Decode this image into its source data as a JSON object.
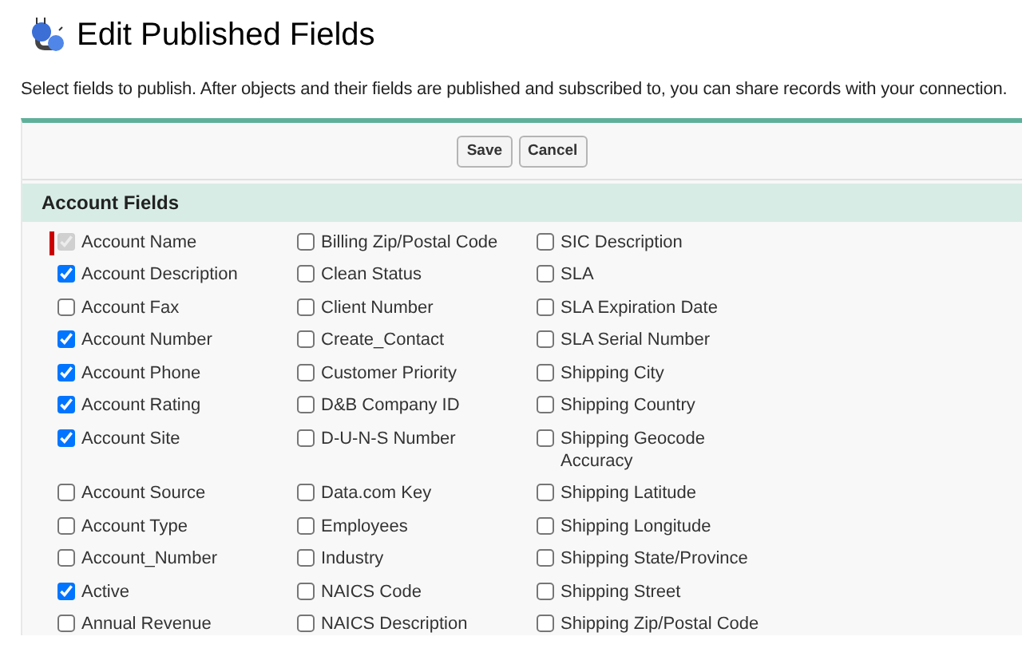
{
  "page": {
    "title": "Edit Published Fields",
    "description": "Select fields to publish. After objects and their fields are published and subscribed to, you can share records with your connection."
  },
  "buttons": [
    "Save",
    "Cancel"
  ],
  "section": {
    "title": "Account Fields"
  },
  "fields": [
    {
      "label": "Account Name",
      "checked": true,
      "disabled": true,
      "required": true
    },
    {
      "label": "Billing Zip/Postal Code",
      "checked": false,
      "disabled": false,
      "required": false
    },
    {
      "label": "SIC Description",
      "checked": false,
      "disabled": false,
      "required": false
    },
    {
      "label": "Account Description",
      "checked": true,
      "disabled": false,
      "required": false
    },
    {
      "label": "Clean Status",
      "checked": false,
      "disabled": false,
      "required": false
    },
    {
      "label": "SLA",
      "checked": false,
      "disabled": false,
      "required": false
    },
    {
      "label": "Account Fax",
      "checked": false,
      "disabled": false,
      "required": false
    },
    {
      "label": "Client Number",
      "checked": false,
      "disabled": false,
      "required": false
    },
    {
      "label": "SLA Expiration Date",
      "checked": false,
      "disabled": false,
      "required": false
    },
    {
      "label": "Account Number",
      "checked": true,
      "disabled": false,
      "required": false
    },
    {
      "label": "Create_Contact",
      "checked": false,
      "disabled": false,
      "required": false
    },
    {
      "label": "SLA Serial Number",
      "checked": false,
      "disabled": false,
      "required": false
    },
    {
      "label": "Account Phone",
      "checked": true,
      "disabled": false,
      "required": false
    },
    {
      "label": "Customer Priority",
      "checked": false,
      "disabled": false,
      "required": false
    },
    {
      "label": "Shipping City",
      "checked": false,
      "disabled": false,
      "required": false
    },
    {
      "label": "Account Rating",
      "checked": true,
      "disabled": false,
      "required": false
    },
    {
      "label": "D&B Company ID",
      "checked": false,
      "disabled": false,
      "required": false
    },
    {
      "label": "Shipping Country",
      "checked": false,
      "disabled": false,
      "required": false
    },
    {
      "label": "Account Site",
      "checked": true,
      "disabled": false,
      "required": false
    },
    {
      "label": "D-U-N-S Number",
      "checked": false,
      "disabled": false,
      "required": false
    },
    {
      "label": "Shipping Geocode Accuracy",
      "checked": false,
      "disabled": false,
      "required": false
    },
    {
      "label": "Account Source",
      "checked": false,
      "disabled": false,
      "required": false
    },
    {
      "label": "Data.com Key",
      "checked": false,
      "disabled": false,
      "required": false
    },
    {
      "label": "Shipping Latitude",
      "checked": false,
      "disabled": false,
      "required": false
    },
    {
      "label": "Account Type",
      "checked": false,
      "disabled": false,
      "required": false
    },
    {
      "label": "Employees",
      "checked": false,
      "disabled": false,
      "required": false
    },
    {
      "label": "Shipping Longitude",
      "checked": false,
      "disabled": false,
      "required": false
    },
    {
      "label": "Account_Number",
      "checked": false,
      "disabled": false,
      "required": false
    },
    {
      "label": "Industry",
      "checked": false,
      "disabled": false,
      "required": false
    },
    {
      "label": "Shipping State/Province",
      "checked": false,
      "disabled": false,
      "required": false
    },
    {
      "label": "Active",
      "checked": true,
      "disabled": false,
      "required": false
    },
    {
      "label": "NAICS Code",
      "checked": false,
      "disabled": false,
      "required": false
    },
    {
      "label": "Shipping Street",
      "checked": false,
      "disabled": false,
      "required": false
    },
    {
      "label": "Annual Revenue",
      "checked": false,
      "disabled": false,
      "required": false
    },
    {
      "label": "NAICS Description",
      "checked": false,
      "disabled": false,
      "required": false
    },
    {
      "label": "Shipping Zip/Postal Code",
      "checked": false,
      "disabled": false,
      "required": false
    }
  ]
}
